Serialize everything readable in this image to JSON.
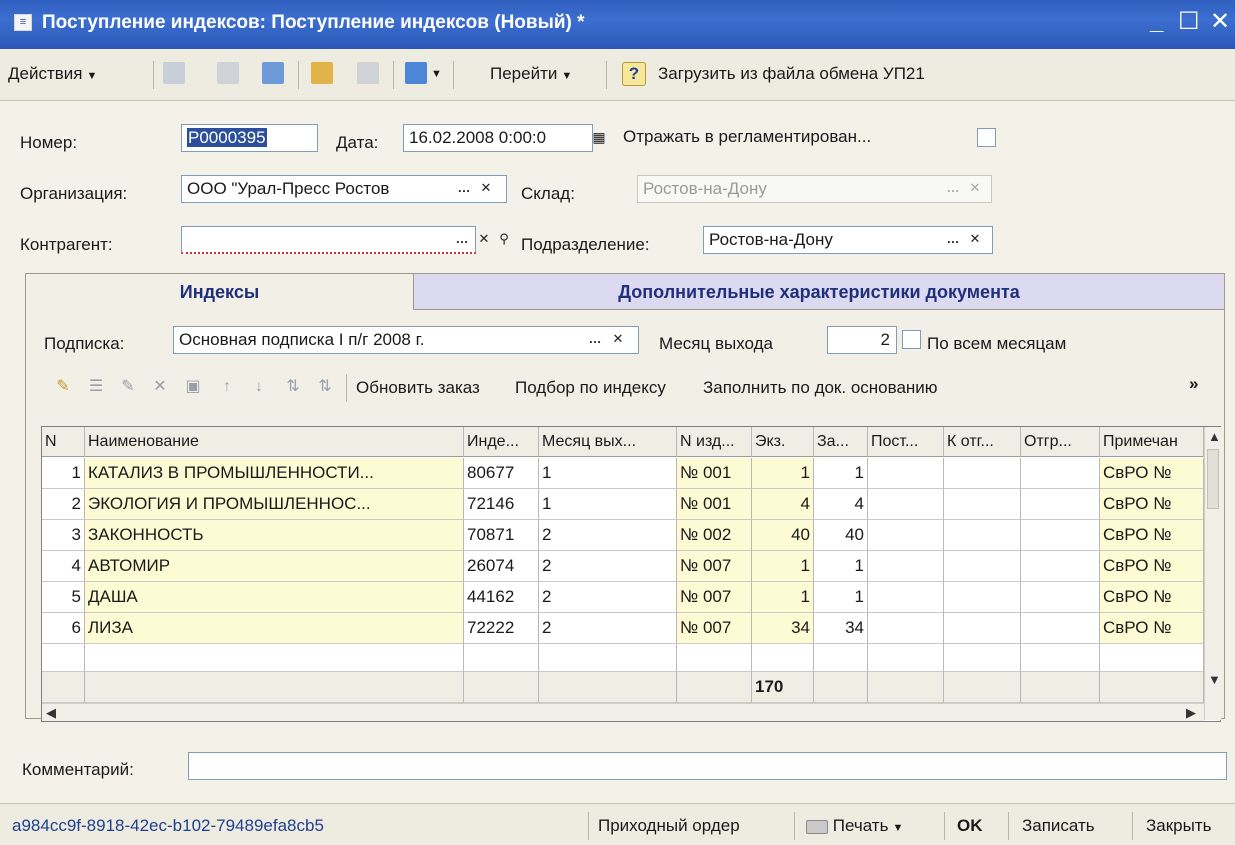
{
  "window": {
    "title": "Поступление индексов: Поступление индексов (Новый) *",
    "minimize": "_",
    "maximize": "☐",
    "close": "✕"
  },
  "toolbar": {
    "actions_label": "Действия",
    "goto_label": "Перейти",
    "help_label": "?",
    "load_label": "Загрузить из файла обмена УП21"
  },
  "form": {
    "number_label": "Номер:",
    "number_value": "Р0000395",
    "date_label": "Дата:",
    "date_value": "16.02.2008 0:00:0",
    "reflect_label": "Отражать в регламентирован...",
    "org_label": "Организация:",
    "org_value": "ООО \"Урал-Пресс Ростов",
    "warehouse_label": "Склад:",
    "warehouse_value": "Ростов-на-Дону",
    "counterparty_label": "Контрагент:",
    "counterparty_value": "",
    "division_label": "Подразделение:",
    "division_value": "Ростов-на-Дону"
  },
  "tabs": {
    "active": "Индексы",
    "inactive": "Дополнительные характеристики документа"
  },
  "subscription": {
    "label": "Подписка:",
    "value": "Основная подписка I п/г 2008 г.",
    "month_label": "Месяц выхода",
    "month_value": "2",
    "all_months_label": "По всем месяцам"
  },
  "table_toolbar": {
    "update_order": "Обновить заказ",
    "select_by_index": "Подбор по индексу",
    "fill_by_doc": "Заполнить по док. основанию",
    "more": "»"
  },
  "table": {
    "headers": [
      "N",
      "Наименование",
      "Инде...",
      "Месяц вых...",
      "N изд...",
      "Экз.",
      "За...",
      "Пост...",
      "К отг...",
      "Отгр...",
      "Примечан"
    ],
    "rows": [
      [
        "1",
        "КАТАЛИЗ В ПРОМЫШЛЕННОСТИ...",
        "80677",
        "1",
        "№ 001",
        "1",
        "1",
        "",
        "",
        "",
        "СвРО №"
      ],
      [
        "2",
        "ЭКОЛОГИЯ И ПРОМЫШЛЕННОС...",
        "72146",
        "1",
        "№ 001",
        "4",
        "4",
        "",
        "",
        "",
        "СвРО №"
      ],
      [
        "3",
        "ЗАКОННОСТЬ",
        "70871",
        "2",
        "№ 002",
        "40",
        "40",
        "",
        "",
        "",
        "СвРО №"
      ],
      [
        "4",
        "АВТОМИР",
        "26074",
        "2",
        "№ 007",
        "1",
        "1",
        "",
        "",
        "",
        "СвРО №"
      ],
      [
        "5",
        "ДАША",
        "44162",
        "2",
        "№ 007",
        "1",
        "1",
        "",
        "",
        "",
        "СвРО №"
      ],
      [
        "6",
        "ЛИЗА",
        "72222",
        "2",
        "№ 007",
        "34",
        "34",
        "",
        "",
        "",
        "СвРО №"
      ]
    ],
    "total_copies": "170"
  },
  "comment": {
    "label": "Комментарий:",
    "value": ""
  },
  "statusbar": {
    "guid": "a984cc9f-8918-42ec-b102-79489efa8cb5",
    "receipt_order": "Приходный ордер",
    "print_label": "Печать",
    "ok_label": "OK",
    "save_label": "Записать",
    "close_label": "Закрыть"
  }
}
